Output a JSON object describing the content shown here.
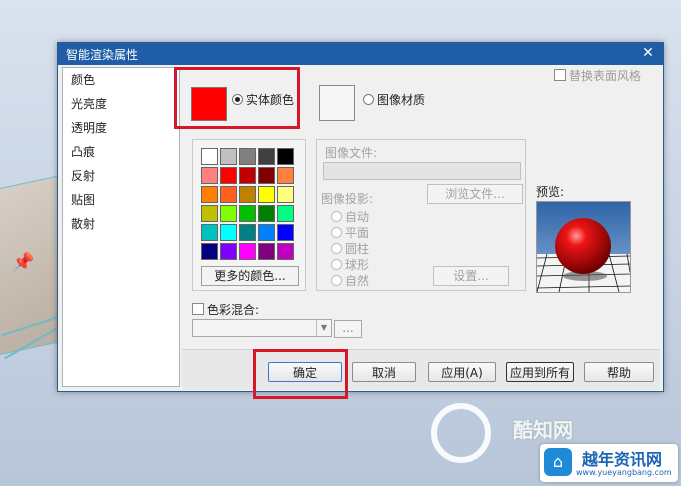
{
  "dialog": {
    "title": "智能渲染属性",
    "close_glyph": "✕"
  },
  "sidebar": {
    "items": [
      {
        "label": "颜色"
      },
      {
        "label": "光亮度"
      },
      {
        "label": "透明度"
      },
      {
        "label": "凸痕"
      },
      {
        "label": "反射"
      },
      {
        "label": "贴图"
      },
      {
        "label": "散射"
      }
    ]
  },
  "material": {
    "solid_label": "实体颜色",
    "solid_selected": true,
    "solid_color": "#ff0000",
    "image_label": "图像材质",
    "replace_style_label": "替换表面风格"
  },
  "palette": {
    "colors": [
      "#ffffff",
      "#c0c0c0",
      "#808080",
      "#404040",
      "#000000",
      "#ff8080",
      "#ff0000",
      "#c00000",
      "#800000",
      "#ff8040",
      "#ff8000",
      "#ff6020",
      "#c08000",
      "#ffff00",
      "#ffff80",
      "#c0c000",
      "#80ff00",
      "#00c000",
      "#008000",
      "#00ff80",
      "#00c0c0",
      "#00ffff",
      "#008080",
      "#0080ff",
      "#0000ff",
      "#000080",
      "#8000ff",
      "#ff00ff",
      "#800080",
      "#c000c0"
    ],
    "more_colors_label": "更多的颜色..."
  },
  "image_panel": {
    "file_label": "图像文件:",
    "browse_label": "浏览文件...",
    "projection_label": "图像投影:",
    "projection_options": [
      "自动",
      "平面",
      "圆柱",
      "球形",
      "自然"
    ],
    "settings_label": "设置..."
  },
  "preview": {
    "label": "预览:"
  },
  "blend": {
    "label": "色彩混合:",
    "more_label": "..."
  },
  "buttons": {
    "ok": "确定",
    "cancel": "取消",
    "apply": "应用(A)",
    "apply_all": "应用到所有",
    "help": "帮助"
  },
  "watermark": {
    "brand": "酷知网",
    "badge_title": "越年资讯网",
    "badge_url": "www.yueyangbang.com"
  }
}
